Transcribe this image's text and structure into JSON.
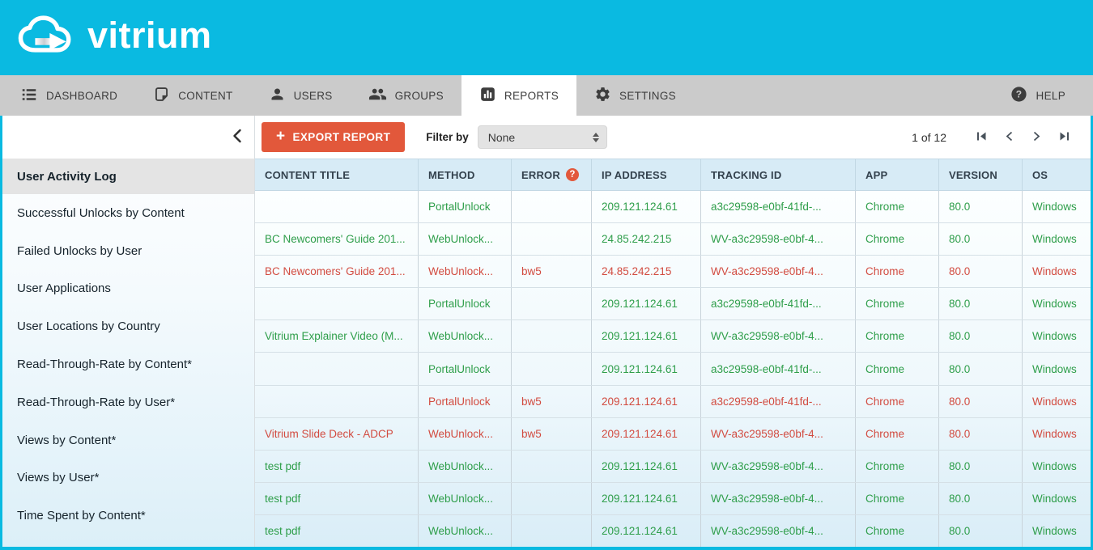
{
  "brand": {
    "logo_text": "vitrium"
  },
  "colors": {
    "accent_cyan": "#0ABAE1",
    "nav_gray": "#CBCBCB",
    "button_orange": "#E2583B",
    "success_green": "#2E9E4A",
    "error_red": "#D24B40",
    "table_header_blue": "#D7EBF6"
  },
  "nav": {
    "items": [
      {
        "label": "DASHBOARD",
        "icon": "dashboard-list-icon",
        "active": false
      },
      {
        "label": "CONTENT",
        "icon": "document-icon",
        "active": false
      },
      {
        "label": "USERS",
        "icon": "user-icon",
        "active": false
      },
      {
        "label": "GROUPS",
        "icon": "users-group-icon",
        "active": false
      },
      {
        "label": "REPORTS",
        "icon": "bar-chart-icon",
        "active": true
      },
      {
        "label": "SETTINGS",
        "icon": "gear-icon",
        "active": false
      }
    ],
    "help": {
      "label": "HELP",
      "icon": "question-mark-icon"
    }
  },
  "toolbar": {
    "export_button": {
      "plus": "+",
      "label": "EXPORT REPORT"
    },
    "filter": {
      "label": "Filter by",
      "value": "None"
    },
    "pagination": {
      "page_text": "1 of 12",
      "buttons": [
        "first-page-icon",
        "previous-page-icon",
        "next-page-icon",
        "last-page-icon"
      ]
    }
  },
  "sidebar": {
    "items": [
      {
        "label": "User Activity Log",
        "active": true
      },
      {
        "label": "Successful Unlocks by Content",
        "active": false
      },
      {
        "label": "Failed Unlocks by User",
        "active": false
      },
      {
        "label": "User Applications",
        "active": false
      },
      {
        "label": "User Locations by Country",
        "active": false
      },
      {
        "label": "Read-Through-Rate by Content*",
        "active": false
      },
      {
        "label": "Read-Through-Rate by User*",
        "active": false
      },
      {
        "label": "Views by Content*",
        "active": false
      },
      {
        "label": "Views by User*",
        "active": false
      },
      {
        "label": "Time Spent by Content*",
        "active": false
      }
    ]
  },
  "table": {
    "columns": [
      "CONTENT TITLE",
      "METHOD",
      "ERROR",
      "IP ADDRESS",
      "TRACKING ID",
      "APP",
      "VERSION",
      "OS"
    ],
    "error_help_icon": "?",
    "rows": [
      {
        "content_title": "",
        "method": "PortalUnlock",
        "error": "",
        "ip_address": "209.121.124.61",
        "tracking_id": "a3c29598-e0bf-41fd-...",
        "app": "Chrome",
        "version": "80.0",
        "os": "Windows",
        "status": "success"
      },
      {
        "content_title": "BC Newcomers' Guide 201...",
        "method": "WebUnlock...",
        "error": "",
        "ip_address": "24.85.242.215",
        "tracking_id": "WV-a3c29598-e0bf-4...",
        "app": "Chrome",
        "version": "80.0",
        "os": "Windows",
        "status": "success"
      },
      {
        "content_title": "BC Newcomers' Guide 201...",
        "method": "WebUnlock...",
        "error": "bw5",
        "ip_address": "24.85.242.215",
        "tracking_id": "WV-a3c29598-e0bf-4...",
        "app": "Chrome",
        "version": "80.0",
        "os": "Windows",
        "status": "error"
      },
      {
        "content_title": "",
        "method": "PortalUnlock",
        "error": "",
        "ip_address": "209.121.124.61",
        "tracking_id": "a3c29598-e0bf-41fd-...",
        "app": "Chrome",
        "version": "80.0",
        "os": "Windows",
        "status": "success"
      },
      {
        "content_title": "Vitrium Explainer Video (M...",
        "method": "WebUnlock...",
        "error": "",
        "ip_address": "209.121.124.61",
        "tracking_id": "WV-a3c29598-e0bf-4...",
        "app": "Chrome",
        "version": "80.0",
        "os": "Windows",
        "status": "success"
      },
      {
        "content_title": "",
        "method": "PortalUnlock",
        "error": "",
        "ip_address": "209.121.124.61",
        "tracking_id": "a3c29598-e0bf-41fd-...",
        "app": "Chrome",
        "version": "80.0",
        "os": "Windows",
        "status": "success"
      },
      {
        "content_title": "",
        "method": "PortalUnlock",
        "error": "bw5",
        "ip_address": "209.121.124.61",
        "tracking_id": "a3c29598-e0bf-41fd-...",
        "app": "Chrome",
        "version": "80.0",
        "os": "Windows",
        "status": "error"
      },
      {
        "content_title": "Vitrium Slide Deck - ADCP",
        "method": "WebUnlock...",
        "error": "bw5",
        "ip_address": "209.121.124.61",
        "tracking_id": "WV-a3c29598-e0bf-4...",
        "app": "Chrome",
        "version": "80.0",
        "os": "Windows",
        "status": "error"
      },
      {
        "content_title": "test pdf",
        "method": "WebUnlock...",
        "error": "",
        "ip_address": "209.121.124.61",
        "tracking_id": "WV-a3c29598-e0bf-4...",
        "app": "Chrome",
        "version": "80.0",
        "os": "Windows",
        "status": "success"
      },
      {
        "content_title": "test pdf",
        "method": "WebUnlock...",
        "error": "",
        "ip_address": "209.121.124.61",
        "tracking_id": "WV-a3c29598-e0bf-4...",
        "app": "Chrome",
        "version": "80.0",
        "os": "Windows",
        "status": "success"
      },
      {
        "content_title": "test pdf",
        "method": "WebUnlock...",
        "error": "",
        "ip_address": "209.121.124.61",
        "tracking_id": "WV-a3c29598-e0bf-4...",
        "app": "Chrome",
        "version": "80.0",
        "os": "Windows",
        "status": "success"
      }
    ]
  }
}
